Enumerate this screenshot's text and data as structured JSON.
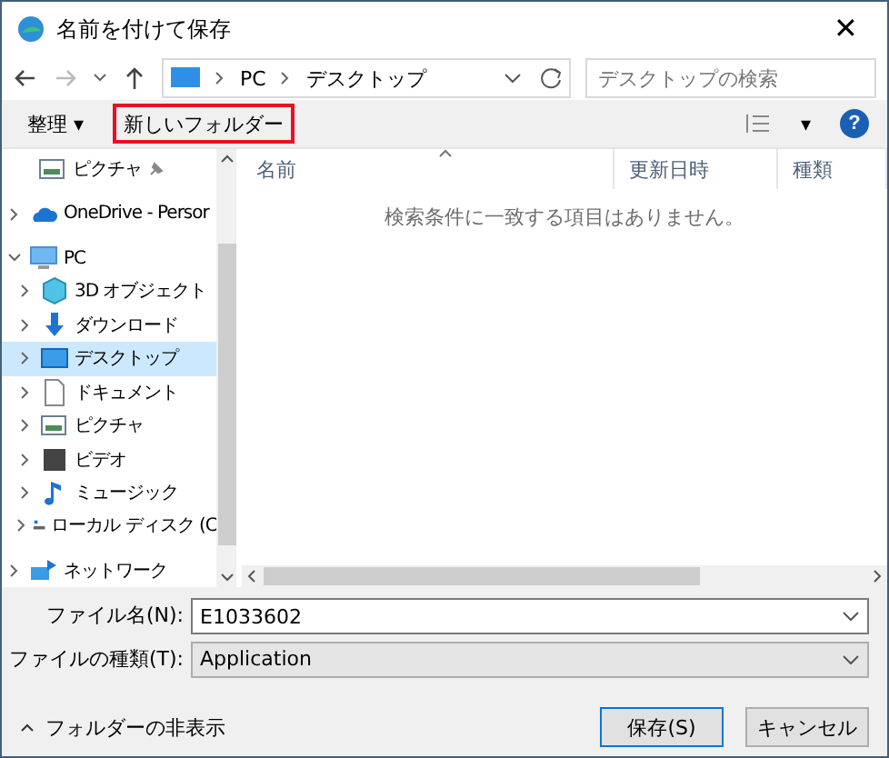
{
  "window": {
    "title": "名前を付けて保存",
    "close": "✕"
  },
  "address": {
    "path": [
      "PC",
      "デスクトップ"
    ],
    "search_placeholder": "デスクトップの検索"
  },
  "toolbar": {
    "organize": "整理 ▾",
    "new_folder": "新しいフォルダー",
    "new_folder_highlighted": true,
    "view": "▾",
    "help": "?"
  },
  "nav": [
    {
      "label": "ピクチャ",
      "pinned": true,
      "selected": false
    },
    {
      "label": "OneDrive - Persor",
      "expanded": false,
      "selected": false
    },
    {
      "label": "PC",
      "expanded": true,
      "selected": false,
      "children": [
        {
          "label": "3D オブジェクト",
          "expanded": false,
          "selected": false
        },
        {
          "label": "ダウンロード",
          "expanded": false,
          "selected": false
        },
        {
          "label": "デスクトップ",
          "expanded": false,
          "selected": true
        },
        {
          "label": "ドキュメント",
          "expanded": false,
          "selected": false
        },
        {
          "label": "ピクチャ",
          "expanded": false,
          "selected": false
        },
        {
          "label": "ビデオ",
          "expanded": false,
          "selected": false
        },
        {
          "label": "ミュージック",
          "expanded": false,
          "selected": false
        },
        {
          "label": "ローカル ディスク (C",
          "expanded": false,
          "selected": false
        }
      ]
    },
    {
      "label": "ネットワーク",
      "expanded": false,
      "selected": false
    }
  ],
  "table": {
    "columns": [
      "名前",
      "更新日時",
      "種類"
    ],
    "empty_message": "検索条件に一致する項目はありません。"
  },
  "form": {
    "filename_label": "ファイル名(N):",
    "filename": "E1033602",
    "type_label": "ファイルの種類(T):",
    "type": "Application"
  },
  "footer": {
    "hide_folders": "フォルダーの非表示",
    "buttons": [
      "保存(S)",
      "キャンセル"
    ]
  }
}
